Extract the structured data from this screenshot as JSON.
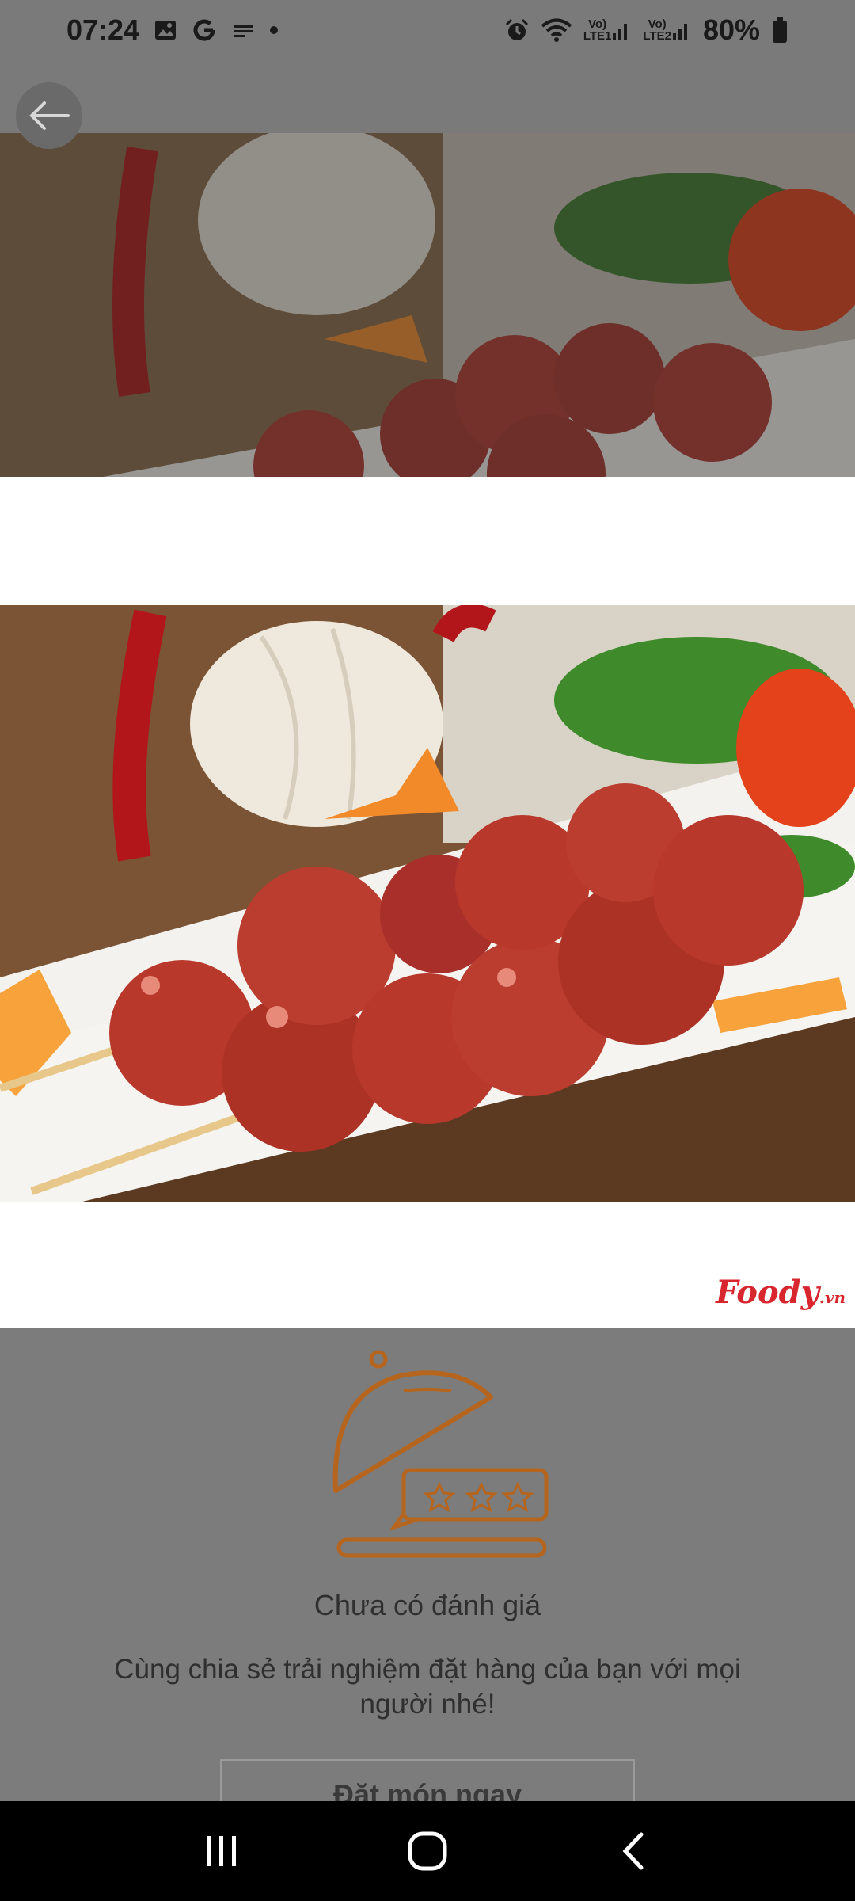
{
  "status_bar": {
    "time": "07:24",
    "left_icons": [
      "gallery-icon",
      "google-icon",
      "notification-app-icon",
      "dot-icon"
    ],
    "right_icons": [
      "alarm-icon",
      "wifi-icon",
      "lte1-signal-icon",
      "lte2-signal-icon",
      "battery-icon"
    ],
    "sim1_label_top": "Vo)",
    "sim1_label_bottom": "LTE1",
    "sim2_label_top": "Vo)",
    "sim2_label_bottom": "LTE2",
    "battery": "80%"
  },
  "header": {
    "back_icon": "arrow-left-icon"
  },
  "photo": {
    "watermark": "Foody.vn",
    "logo_main": "Foody",
    "logo_suffix": ".vn"
  },
  "review": {
    "illustration_icon": "food-cloche-rating-icon",
    "title": "Chưa có đánh giá",
    "description": "Cùng chia sẻ trải nghiệm đặt hàng của bạn với mọi người nhé!",
    "button_label": "Đặt món ngay"
  },
  "nav": {
    "recents_icon": "recent-apps-icon",
    "home_icon": "home-icon",
    "back_icon": "nav-back-icon"
  },
  "colors": {
    "accent": "#b5651d",
    "overlay": "#7c7c7c",
    "logo": "#d8262f"
  }
}
